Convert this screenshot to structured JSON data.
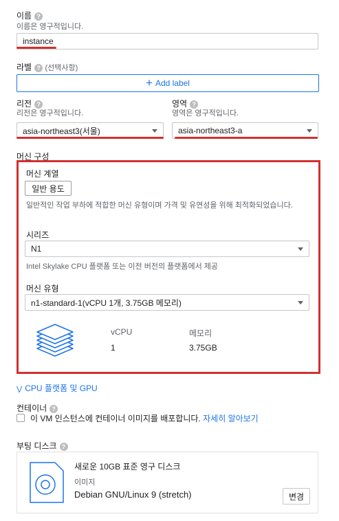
{
  "name": {
    "label": "이름",
    "note": "이름은 영구적입니다.",
    "value": "instance"
  },
  "labels": {
    "label": "라벨",
    "optional": "(선택사항)",
    "add_label": "Add label"
  },
  "region": {
    "label": "리전",
    "note": "리전은 영구적입니다.",
    "value": "asia-northeast3(서울)"
  },
  "zone": {
    "label": "영역",
    "note": "영역은 영구적입니다.",
    "value": "asia-northeast3-a"
  },
  "machine_config": {
    "label": "머신 구성",
    "family_label": "머신 계열",
    "family_chip": "일반 용도",
    "family_desc": "일반적인 작업 부하에 적합한 머신 유형이며 가격 및 유연성을 위해 최적화되었습니다.",
    "series_label": "시리즈",
    "series_value": "N1",
    "series_desc": "Intel Skylake CPU 플랫폼 또는 이전 버전의 플랫폼에서 제공",
    "type_label": "머신 유형",
    "type_value": "n1-standard-1(vCPU 1개, 3.75GB 메모리)",
    "vcpu_header": "vCPU",
    "memory_header": "메모리",
    "vcpu_value": "1",
    "memory_value": "3.75GB"
  },
  "cpu_platform_link": "CPU 플랫폼 및 GPU",
  "container": {
    "label": "컨테이너",
    "checkbox_text": "이 VM 인스턴스에 컨테이너 이미지를 배포합니다.",
    "learn_more": "자세히 알아보기"
  },
  "boot_disk": {
    "label": "부팅 디스크",
    "title": "새로운 10GB 표준 영구 디스크",
    "image_label": "이미지",
    "image_value": "Debian GNU/Linux 9 (stretch)",
    "change_button": "변경"
  },
  "colors": {
    "accent": "#1a73e8",
    "highlight": "#d32f2f"
  }
}
